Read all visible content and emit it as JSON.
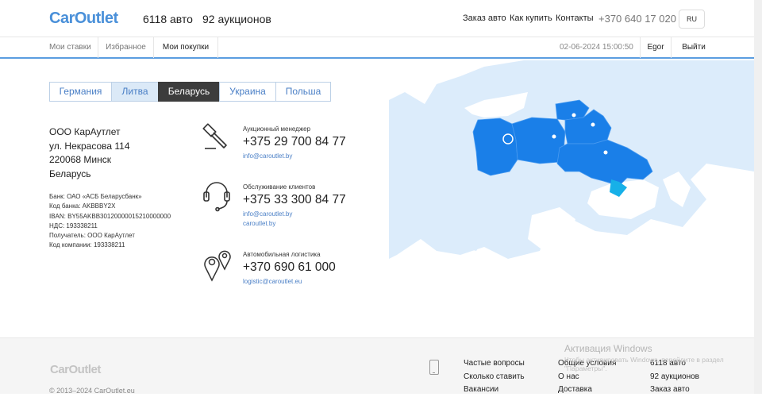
{
  "header": {
    "logo": "CarOutlet",
    "cars_count": "6118 авто",
    "auctions_count": "92 аукционов",
    "nav": [
      "Заказ авто",
      "Как купить",
      "Контакты"
    ],
    "phone": "+370 640 17 020",
    "lang": "RU"
  },
  "subnav": {
    "tabs": [
      "Мои ставки",
      "Избранное",
      "Мои покупки"
    ],
    "active_tab": "Мои покупки",
    "datetime": "02-06-2024 15:00:50",
    "user": "Egor",
    "logout": "Выйти"
  },
  "country_tabs": [
    "Германия",
    "Литва",
    "Беларусь",
    "Украина",
    "Польша"
  ],
  "active_country": "Беларусь",
  "company": {
    "name": "ООО КарАутлет",
    "street": "ул. Некрасова 114",
    "city": "220068 Минск",
    "country": "Беларусь"
  },
  "bank": {
    "bank": "Банк: ОАО «АСБ Беларусбанк»",
    "bank_code": "Код банка: AKBBBY2X",
    "iban": "IBAN: BY55AKBB30120000015210000000",
    "vat": "НДС: 193338211",
    "recipient": "Получатель: ООО КарАутлет",
    "company_code": "Код компании: 193338211"
  },
  "contacts": [
    {
      "label": "Аукционный менеджер",
      "phone": "+375 29 700 84 77",
      "links": [
        "info@caroutlet.by"
      ],
      "icon": "gavel-icon"
    },
    {
      "label": "Обслуживание клиентов",
      "phone": "+375 33 300 84 77",
      "links": [
        "info@caroutlet.by",
        "caroutlet.by"
      ],
      "icon": "headset-icon"
    },
    {
      "label": "Автомобильная логистика",
      "phone": "+370 690 61 000",
      "links": [
        "logistic@caroutlet.eu"
      ],
      "icon": "map-pins-icon"
    }
  ],
  "footer": {
    "logo": "CarOutlet",
    "copyright": "© 2013–2024 CarOutlet.eu",
    "col1": [
      "Частые вопросы",
      "Сколько ставить",
      "Вакансии"
    ],
    "col2": [
      "Общие условия",
      "О нас",
      "Доставка"
    ],
    "col3": [
      "6118 авто",
      "92 аукционов",
      "Заказ авто"
    ]
  },
  "watermark": {
    "title": "Активация Windows",
    "text": "Чтобы активировать Windows, перейдите в раздел \"Параметры\"."
  },
  "colors": {
    "brand": "#4a90d9",
    "map_water": "#ffffff",
    "map_land": "#dcecfb",
    "map_highlight": "#1a7fe8",
    "map_crimea": "#17b0e8"
  }
}
